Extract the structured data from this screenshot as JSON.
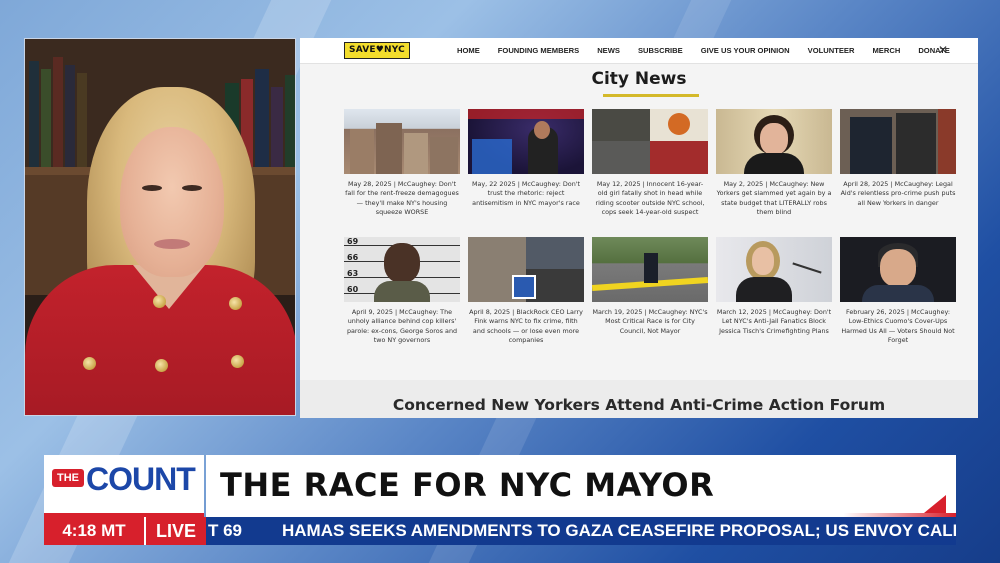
{
  "website": {
    "logo_text": "SAVE♥NYC",
    "nav": [
      "HOME",
      "FOUNDING MEMBERS",
      "NEWS",
      "SUBSCRIBE",
      "GIVE US YOUR OPINION",
      "VOLUNTEER",
      "MERCH",
      "DONATE"
    ],
    "x_icon": "✕",
    "section_title": "City News",
    "articles": [
      {
        "caption": "May 28, 2025 | McCaughey: Don't fall for the rent-freeze demagogues — they'll make NY's housing squeeze WORSE",
        "thumb": "brownstones"
      },
      {
        "caption": "May, 22 2025 | McCaughey: Don't trust the rhetoric: reject antisemitism in NYC mayor's race",
        "thumb": "speaker-stage"
      },
      {
        "caption": "May 12, 2025 | Innocent 16-year-old girl fatally shot in head while riding scooter outside NYC school, cops seek 14-year-old suspect",
        "thumb": "street-collage"
      },
      {
        "caption": "May 2, 2025 | McCaughey: New Yorkers get slammed yet again by a state budget that LITERALLY robs them blind",
        "thumb": "governor"
      },
      {
        "caption": "April 28, 2025 | McCaughey: Legal Aid's relentless pro-crime push puts all New Yorkers in danger",
        "thumb": "arrest"
      },
      {
        "caption": "April 9, 2025 | McCaughey: The unholy alliance behind cop killers' parole: ex-cons, George Soros and two NY governors",
        "thumb": "mugshot"
      },
      {
        "caption": "April 8, 2025 | BlackRock CEO Larry Fink warns NYC to fix crime, filth and schools — or lose even more companies",
        "thumb": "city-collage"
      },
      {
        "caption": "March 19, 2025 | McCaughey: NYC's Most Critical Race is for City Council, Not Mayor",
        "thumb": "crime-scene"
      },
      {
        "caption": "March 12, 2025 | McCaughey: Don't Let NYC's Anti-Jail Fanatics Block Jessica Tisch's Crimefighting Plans",
        "thumb": "commissioner"
      },
      {
        "caption": "February 26, 2025 | McCaughey: Low-Ethics Cuomo's Cover-Ups Harmed Us All — Voters Should Not Forget",
        "thumb": "cuomo"
      }
    ],
    "mugshot_heights": [
      "69",
      "66",
      "63",
      "60"
    ],
    "forum_headline": "Concerned New Yorkers Attend Anti-Crime Action Forum"
  },
  "lower_third": {
    "the": "THE",
    "count": "COUNT",
    "headline": "THE RACE FOR NYC MAYOR",
    "time": "4:18 MT",
    "live": "LIVE",
    "ticker_fragment": "T 69",
    "ticker_text": "HAMAS SEEKS AMENDMENTS TO GAZA CEASEFIRE PROPOSAL; US ENVOY CALLS IT 'U"
  },
  "colors": {
    "brand_red": "#d7202c",
    "brand_blue": "#1c47a8",
    "ticker_blue": "#123a8f",
    "logo_yellow": "#f3dd2c",
    "jacket_red": "#c3222c"
  }
}
